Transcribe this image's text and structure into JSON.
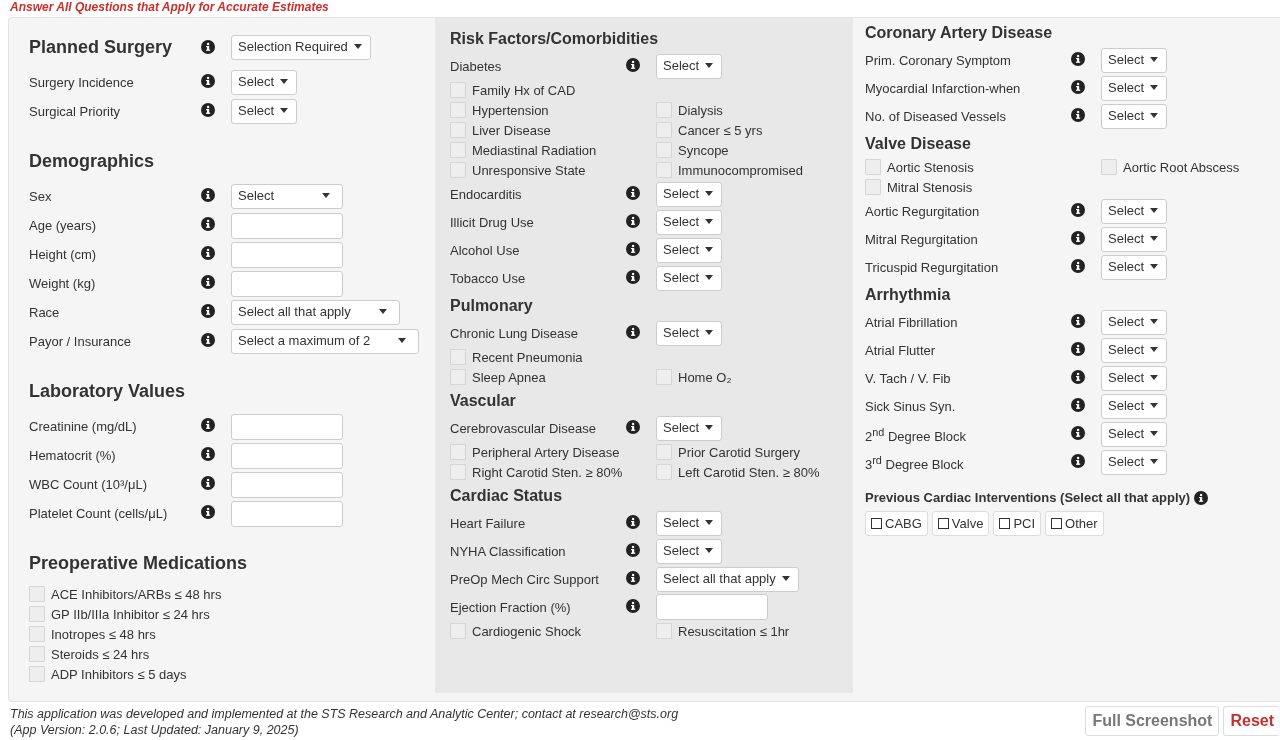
{
  "notice": "Answer All Questions that Apply for Accurate Estimates",
  "columns": [
    {
      "sections": [
        {
          "title": "Planned Surgery",
          "info": true,
          "control": {
            "kind": "select",
            "value": "Selection Required"
          },
          "items": [
            {
              "kind": "select",
              "label": "Surgery Incidence",
              "info": true,
              "value": "Select"
            },
            {
              "kind": "select",
              "label": "Surgical Priority",
              "info": true,
              "value": "Select"
            }
          ]
        },
        {
          "title": "Demographics",
          "items": [
            {
              "kind": "dropdown",
              "label": "Sex",
              "info": true,
              "value": "Select"
            },
            {
              "kind": "input",
              "label": "Age (years)",
              "info": true
            },
            {
              "kind": "input",
              "label": "Height (cm)",
              "info": true
            },
            {
              "kind": "input",
              "label": "Weight (kg)",
              "info": true
            },
            {
              "kind": "dropdown",
              "label": "Race",
              "info": true,
              "value": "Select all that apply"
            },
            {
              "kind": "dropdown",
              "label": "Payor / Insurance",
              "info": true,
              "value": "Select a maximum of 2"
            }
          ]
        },
        {
          "title": "Laboratory Values",
          "items": [
            {
              "kind": "input",
              "label": "Creatinine (mg/dL)",
              "info": true
            },
            {
              "kind": "input",
              "label": "Hematocrit (%)",
              "info": true
            },
            {
              "kind": "input",
              "label": "WBC Count (10³/μL)",
              "info": true
            },
            {
              "kind": "input",
              "label": "Platelet Count (cells/μL)",
              "info": true
            }
          ]
        },
        {
          "title": "Preoperative Medications",
          "items": [
            {
              "kind": "checks",
              "checks": [
                {
                  "label": "ACE Inhibitors/ARBs ≤ 48 hrs",
                  "checked": false
                }
              ]
            },
            {
              "kind": "checks",
              "checks": [
                {
                  "label": "GP IIb/IIIa Inhibitor ≤ 24 hrs",
                  "checked": false
                }
              ]
            },
            {
              "kind": "checks",
              "checks": [
                {
                  "label": "Inotropes ≤ 48 hrs",
                  "checked": false
                }
              ]
            },
            {
              "kind": "checks",
              "checks": [
                {
                  "label": "Steroids ≤ 24 hrs",
                  "checked": false
                }
              ]
            },
            {
              "kind": "checks",
              "checks": [
                {
                  "label": "ADP Inhibitors ≤ 5 days",
                  "checked": false
                }
              ]
            }
          ]
        }
      ]
    },
    {
      "sections": [
        {
          "title": "Risk Factors/Comorbidities",
          "items": [
            {
              "kind": "select",
              "label": "Diabetes",
              "info": true,
              "value": "Select"
            },
            {
              "kind": "checks",
              "checks": [
                {
                  "label": "Family Hx of CAD",
                  "checked": false
                }
              ]
            },
            {
              "kind": "checks",
              "checks": [
                {
                  "label": "Hypertension",
                  "checked": false
                },
                {
                  "label": "Dialysis",
                  "checked": false
                }
              ]
            },
            {
              "kind": "checks",
              "checks": [
                {
                  "label": "Liver Disease",
                  "checked": false
                },
                {
                  "label": "Cancer ≤ 5 yrs",
                  "checked": false
                }
              ]
            },
            {
              "kind": "checks",
              "checks": [
                {
                  "label": "Mediastinal Radiation",
                  "checked": false
                },
                {
                  "label": "Syncope",
                  "checked": false
                }
              ]
            },
            {
              "kind": "checks",
              "checks": [
                {
                  "label": "Unresponsive State",
                  "checked": false
                },
                {
                  "label": "Immunocompromised",
                  "checked": false
                }
              ]
            },
            {
              "kind": "select",
              "label": "Endocarditis",
              "info": true,
              "value": "Select"
            },
            {
              "kind": "select",
              "label": "Illicit Drug Use",
              "info": true,
              "value": "Select"
            },
            {
              "kind": "select",
              "label": "Alcohol Use",
              "info": true,
              "value": "Select"
            },
            {
              "kind": "select",
              "label": "Tobacco Use",
              "info": true,
              "value": "Select"
            }
          ]
        },
        {
          "title": "Pulmonary",
          "items": [
            {
              "kind": "select",
              "label": "Chronic Lung Disease",
              "info": true,
              "value": "Select"
            },
            {
              "kind": "checks",
              "checks": [
                {
                  "label": "Recent Pneumonia",
                  "checked": false
                }
              ]
            },
            {
              "kind": "checks",
              "checks": [
                {
                  "label": "Sleep Apnea",
                  "checked": false
                },
                {
                  "label": "Home O₂",
                  "checked": false
                }
              ]
            }
          ]
        },
        {
          "title": "Vascular",
          "items": [
            {
              "kind": "select",
              "label": "Cerebrovascular Disease",
              "info": true,
              "value": "Select"
            },
            {
              "kind": "checks",
              "checks": [
                {
                  "label": "Peripheral Artery Disease",
                  "checked": false
                },
                {
                  "label": "Prior Carotid Surgery",
                  "checked": false
                }
              ]
            },
            {
              "kind": "checks",
              "checks": [
                {
                  "label": "Right Carotid Sten. ≥ 80%",
                  "checked": false
                },
                {
                  "label": "Left Carotid Sten. ≥ 80%",
                  "checked": false
                }
              ]
            }
          ]
        },
        {
          "title": "Cardiac Status",
          "items": [
            {
              "kind": "select",
              "label": "Heart Failure",
              "info": true,
              "value": "Select"
            },
            {
              "kind": "select",
              "label": "NYHA Classification",
              "info": true,
              "value": "Select"
            },
            {
              "kind": "select",
              "label": "PreOp Mech Circ Support",
              "info": true,
              "value": "Select all that apply"
            },
            {
              "kind": "input",
              "label": "Ejection Fraction (%)",
              "info": true
            },
            {
              "kind": "checks",
              "checks": [
                {
                  "label": "Cardiogenic Shock",
                  "checked": false
                },
                {
                  "label": "Resuscitation ≤ 1hr",
                  "checked": false
                }
              ]
            }
          ]
        }
      ]
    },
    {
      "sections": [
        {
          "title": "Coronary Artery Disease",
          "items": [
            {
              "kind": "select",
              "label": "Prim. Coronary Symptom",
              "info": true,
              "value": "Select"
            },
            {
              "kind": "select",
              "label": "Myocardial Infarction-when",
              "info": true,
              "value": "Select"
            },
            {
              "kind": "select",
              "label": "No. of Diseased Vessels",
              "info": true,
              "value": "Select"
            }
          ]
        },
        {
          "title": "Valve Disease",
          "items": [
            {
              "kind": "checks",
              "checks": [
                {
                  "label": "Aortic Stenosis",
                  "checked": false
                },
                {
                  "label": "Aortic Root Abscess",
                  "checked": false
                }
              ]
            },
            {
              "kind": "checks",
              "checks": [
                {
                  "label": "Mitral Stenosis",
                  "checked": false
                }
              ]
            },
            {
              "kind": "select",
              "label": "Aortic Regurgitation",
              "info": true,
              "value": "Select"
            },
            {
              "kind": "select",
              "label": "Mitral Regurgitation",
              "info": true,
              "value": "Select"
            },
            {
              "kind": "select",
              "label": "Tricuspid Regurgitation",
              "info": true,
              "value": "Select"
            }
          ]
        },
        {
          "title": "Arrhythmia",
          "items": [
            {
              "kind": "select",
              "label": "Atrial Fibrillation",
              "info": true,
              "value": "Select"
            },
            {
              "kind": "select",
              "label": "Atrial Flutter",
              "info": true,
              "value": "Select"
            },
            {
              "kind": "select",
              "label": "V. Tach / V. Fib",
              "info": true,
              "value": "Select"
            },
            {
              "kind": "select",
              "label": "Sick Sinus Syn.",
              "info": true,
              "value": "Select"
            },
            {
              "kind": "select",
              "label": "2$^{nd}$ Degree Block",
              "info": true,
              "value": "Select"
            },
            {
              "kind": "select",
              "label": "3$^{rd}$ Degree Block",
              "info": true,
              "value": "Select"
            }
          ]
        },
        {
          "title": "Previous Cardiac Interventions (Select all that apply)",
          "info": true,
          "small": true,
          "items": [
            {
              "kind": "pills",
              "pills": [
                {
                  "label": "CABG",
                  "checked": false
                },
                {
                  "label": "Valve",
                  "checked": false
                },
                {
                  "label": "PCI",
                  "checked": false
                },
                {
                  "label": "Other",
                  "checked": false
                }
              ]
            }
          ]
        }
      ]
    }
  ],
  "footer": {
    "lines": [
      "This application was developed and implemented at the STS Research and Analytic Center; contact at research@sts.org",
      "(App Version: 2.0.6; Last Updated: January 9, 2025)"
    ],
    "buttons": [
      {
        "label": "Full Screenshot",
        "kind": "secondary"
      },
      {
        "label": "Reset",
        "kind": "danger"
      }
    ]
  }
}
